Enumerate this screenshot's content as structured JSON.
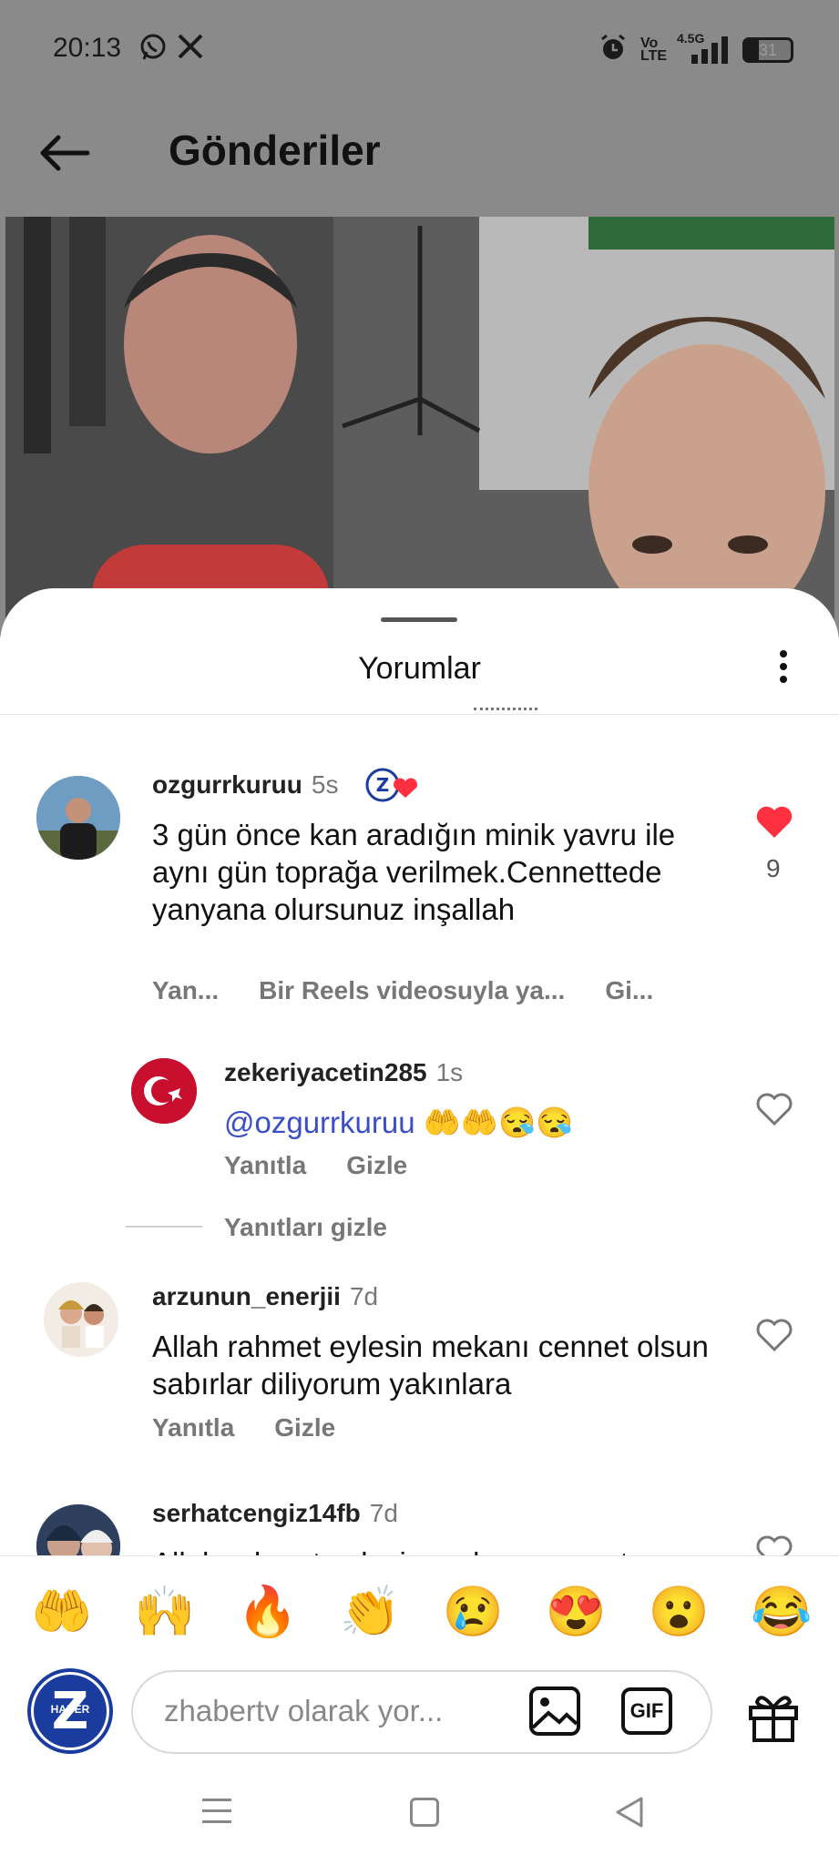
{
  "status_bar": {
    "time": "20:13",
    "apps": [
      "whatsapp-icon",
      "x-icon"
    ],
    "indicators": [
      "alarm-icon",
      "volte-icon",
      "signal-4g-icon"
    ],
    "network_label": "4.5G",
    "volte_label": "Vo LTE",
    "battery": "31"
  },
  "header": {
    "title": "Gönderiler"
  },
  "sheet": {
    "title": "Yorumlar"
  },
  "comments": [
    {
      "username": "ozgurrkuruu",
      "time": "5s",
      "text": "3 gün önce kan aradığın minik yavru ile aynı gün toprağa verilmek.Cennettede yanyana olursunuz inşallah",
      "actions": [
        "Yan...",
        "Bir Reels videosuyla ya...",
        "Gi..."
      ],
      "likes": "9",
      "liked": true
    },
    {
      "username": "zekeriyacetin285",
      "time": "1s",
      "mention": "@ozgurrkuruu",
      "emojis": "🤲🤲😪😪",
      "actions": [
        "Yanıtla",
        "Gizle"
      ],
      "liked": false
    },
    {
      "hide_replies": "Yanıtları gizle"
    },
    {
      "username": "arzunun_enerjii",
      "time": "7d",
      "text": "Allah rahmet eylesin mekanı cennet olsun sabırlar diliyorum yakınlara",
      "actions": [
        "Yanıtla",
        "Gizle"
      ],
      "liked": false
    },
    {
      "username": "serhatcengiz14fb",
      "time": "7d",
      "text": "Allah rahmet eylesin mekanı cennet",
      "liked": false
    }
  ],
  "emoji_bar": [
    "🤲",
    "🙌",
    "🔥",
    "👏",
    "😢",
    "😍",
    "😮",
    "😂"
  ],
  "composer": {
    "avatar_label": "HABER",
    "placeholder": "zhabertv olarak yor...",
    "gif_label": "GIF"
  },
  "colors": {
    "like_red": "#ff3040",
    "mention_blue": "#3a4ec7",
    "brand_blue": "#1a3c9e"
  }
}
